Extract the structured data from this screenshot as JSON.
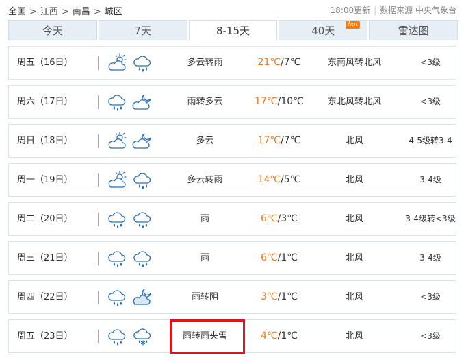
{
  "breadcrumb": {
    "items": [
      "全国",
      "江西",
      "南昌",
      "城区"
    ],
    "separator": ">"
  },
  "update": {
    "time_text": "18:00更新",
    "source_text": "数据来源 中央气象台"
  },
  "tabs": [
    {
      "label": "今天",
      "active": false
    },
    {
      "label": "7天",
      "active": false
    },
    {
      "label": "8-15天",
      "active": true
    },
    {
      "label": "40天",
      "active": false,
      "badge": "hot"
    },
    {
      "label": "雷达图",
      "active": false
    }
  ],
  "colors": {
    "temp_high": "#f07a1e",
    "highlight_box": "#e0131b",
    "tab_bg": "#e7eef6",
    "icon_stroke": "#2a6fb5"
  },
  "forecast": [
    {
      "day": "周五（16日）",
      "icons": [
        "partly-cloudy-icon",
        "rain-icon"
      ],
      "desc": "多云转雨",
      "high": "21℃",
      "low": "/7℃",
      "wind": "东南风转北风",
      "level": "<3级"
    },
    {
      "day": "周六（17日）",
      "icons": [
        "rain-icon",
        "cloudy-night-icon"
      ],
      "desc": "雨转多云",
      "high": "17℃",
      "low": "/10℃",
      "wind": "东北风转北风",
      "level": "<3级"
    },
    {
      "day": "周日（18日）",
      "icons": [
        "partly-cloudy-icon",
        "cloudy-night-icon"
      ],
      "desc": "多云",
      "high": "17℃",
      "low": "/7℃",
      "wind": "北风",
      "level": "4-5级转3-4"
    },
    {
      "day": "周一（19日）",
      "icons": [
        "partly-cloudy-icon",
        "rain-icon"
      ],
      "desc": "多云转雨",
      "high": "14℃",
      "low": "/5℃",
      "wind": "北风",
      "level": "3-4级"
    },
    {
      "day": "周二（20日）",
      "icons": [
        "rain-icon",
        "rain-icon"
      ],
      "desc": "雨",
      "high": "6℃",
      "low": "/3℃",
      "wind": "北风",
      "level": "3-4级转<3级"
    },
    {
      "day": "周三（21日）",
      "icons": [
        "rain-icon",
        "rain-icon"
      ],
      "desc": "雨",
      "high": "6℃",
      "low": "/1℃",
      "wind": "北风",
      "level": "3-4级"
    },
    {
      "day": "周四（22日）",
      "icons": [
        "rain-icon",
        "overcast-night-icon"
      ],
      "desc": "雨转阴",
      "high": "3℃",
      "low": "/1℃",
      "wind": "北风",
      "level": "<3级"
    },
    {
      "day": "周五（23日）",
      "icons": [
        "rain-icon",
        "sleet-icon"
      ],
      "desc": "雨转雨夹雪",
      "high": "4℃",
      "low": "/1℃",
      "wind": "北风",
      "level": "<3级"
    }
  ]
}
